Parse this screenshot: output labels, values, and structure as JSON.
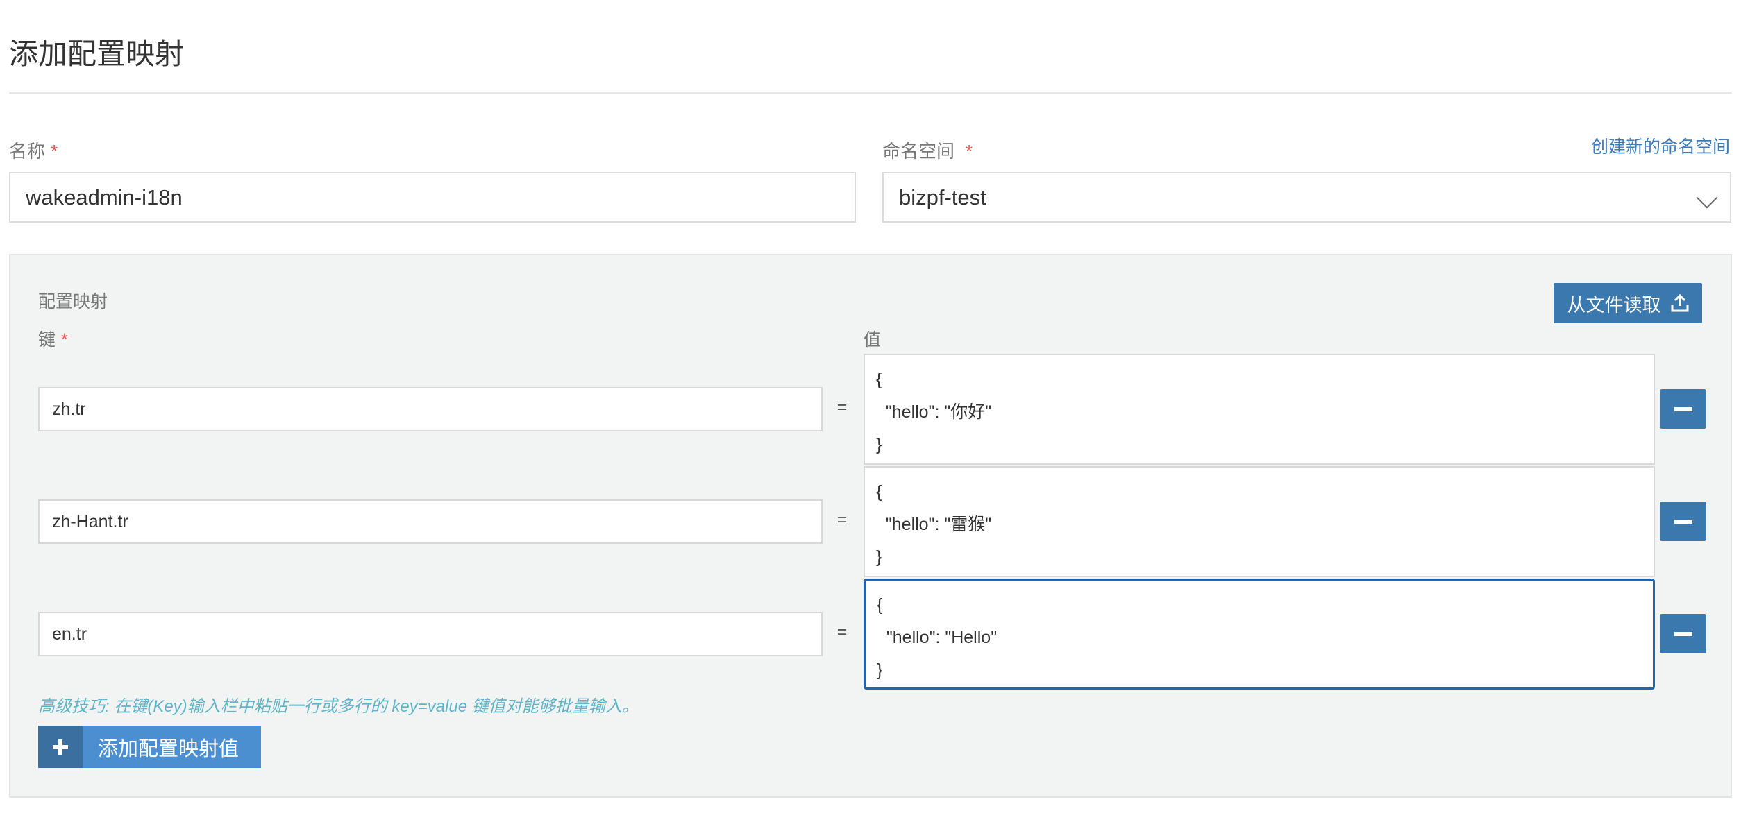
{
  "header": {
    "title": "添加配置映射"
  },
  "form": {
    "name_label": "名称",
    "name_value": "wakeadmin-i18n",
    "namespace_label": "命名空间",
    "namespace_value": "bizpf-test",
    "create_namespace_link": "创建新的命名空间",
    "required_mark": "*"
  },
  "config_map": {
    "section_label": "配置映射",
    "read_from_file_label": "从文件读取",
    "key_column_label": "键",
    "value_column_label": "值",
    "equals_sign": "=",
    "entries": [
      {
        "key": "zh.tr",
        "value": "{\n  \"hello\": \"你好\"\n}"
      },
      {
        "key": "zh-Hant.tr",
        "value": "{\n  \"hello\": \"雷猴\"\n}"
      },
      {
        "key": "en.tr",
        "value": "{\n  \"hello\": \"Hello\"\n}"
      }
    ],
    "hint": "高级技巧: 在键(Key)输入栏中粘贴一行或多行的 key=value 键值对能够批量输入。",
    "add_entry_label": "添加配置映射值"
  },
  "icons": {
    "upload": "upload-icon",
    "chevron": "chevron-down-icon",
    "minus": "minus-icon",
    "plus": "plus-icon"
  },
  "colors": {
    "primary_button": "#3b78ad",
    "add_button": "#4b8fd0",
    "link": "#3d7ab8",
    "focus_border": "#2463b0",
    "required": "#d9534f",
    "hint": "#5fb4c7"
  }
}
